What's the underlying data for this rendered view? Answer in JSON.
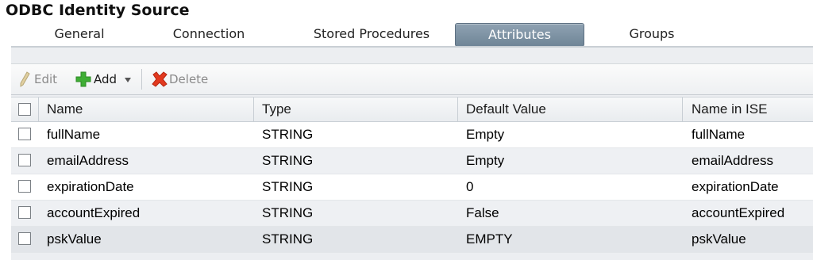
{
  "title": "ODBC Identity Source",
  "tabs": [
    {
      "label": "General"
    },
    {
      "label": "Connection"
    },
    {
      "label": "Stored Procedures"
    },
    {
      "label": "Attributes"
    },
    {
      "label": "Groups"
    }
  ],
  "active_tab": "Attributes",
  "toolbar": {
    "edit_label": "Edit",
    "add_label": "Add",
    "delete_label": "Delete"
  },
  "colors": {
    "active_tab": "#7f94a6",
    "add_icon": "#3fae35",
    "delete_icon": "#e2391f"
  },
  "table": {
    "headers": [
      "Name",
      "Type",
      "Default Value",
      "Name in ISE"
    ],
    "rows": [
      [
        "fullName",
        "STRING",
        "Empty",
        "fullName"
      ],
      [
        "emailAddress",
        "STRING",
        "Empty",
        "emailAddress"
      ],
      [
        "expirationDate",
        "STRING",
        "0",
        "expirationDate"
      ],
      [
        "accountExpired",
        "STRING",
        "False",
        "accountExpired"
      ],
      [
        "pskValue",
        "STRING",
        "EMPTY",
        "pskValue"
      ]
    ]
  }
}
